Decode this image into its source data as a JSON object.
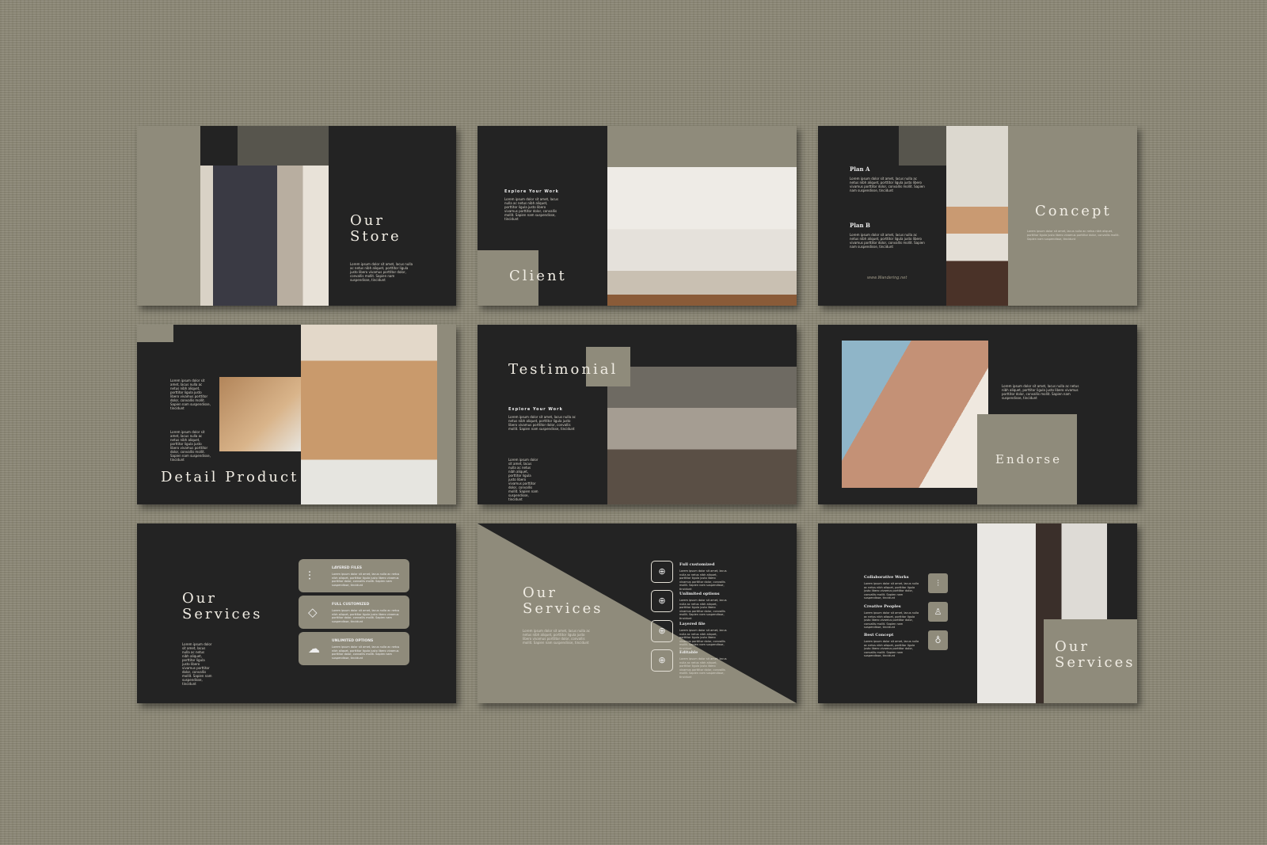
{
  "colors": {
    "background": "#8e8a78",
    "slide_dark": "#232323",
    "accent_beige": "#8f8b7b",
    "accent_gray": "#57554d"
  },
  "lorem_short": "Lorem ipsum dolor sit amet, lacus nulla ac netus nibh aliquet, porttitor ligula justo libero vivamus porttitor dolor, convallis mollit. Sapien nam suspendisse, tincidunt",
  "slides": [
    {
      "title": "Our\nStore"
    },
    {
      "title": "Client",
      "heading": "Explore Your Work"
    },
    {
      "title": "Concept",
      "plan_a": "Plan A",
      "plan_b": "Plan B",
      "website": "www.Wandering.net"
    },
    {
      "title": "Detail Product"
    },
    {
      "title": "Testimonial",
      "heading": "Explore Your Work"
    },
    {
      "title": "Endorse"
    },
    {
      "title": "Our\nServices",
      "cards": [
        {
          "icon": "sliders-icon",
          "glyph": "⫶",
          "label": "LAYERED FILES"
        },
        {
          "icon": "tag-icon",
          "glyph": "◇",
          "label": "FULL CUSTOMIZED"
        },
        {
          "icon": "cloud-icon",
          "glyph": "☁",
          "label": "UNLIMITED OPTIONS"
        }
      ]
    },
    {
      "title": "Our\nServices",
      "items": [
        {
          "icon": "arrow-circle-icon",
          "glyph": "⊕",
          "label": "Full customized"
        },
        {
          "icon": "arrow-circle-icon",
          "glyph": "⊕",
          "label": "Unlimited options"
        },
        {
          "icon": "arrow-circle-icon",
          "glyph": "⊕",
          "label": "Layered file"
        },
        {
          "icon": "arrow-circle-icon",
          "glyph": "⊕",
          "label": "Editable"
        }
      ]
    },
    {
      "title": "Our\nServices",
      "items": [
        {
          "icon": "sliders-icon",
          "glyph": "⫶",
          "label": "Collaborative Works"
        },
        {
          "icon": "user-icon",
          "glyph": "♙",
          "label": "Creative Peoples"
        },
        {
          "icon": "lightbulb-icon",
          "glyph": "♁",
          "label": "Best Concept"
        }
      ]
    }
  ]
}
